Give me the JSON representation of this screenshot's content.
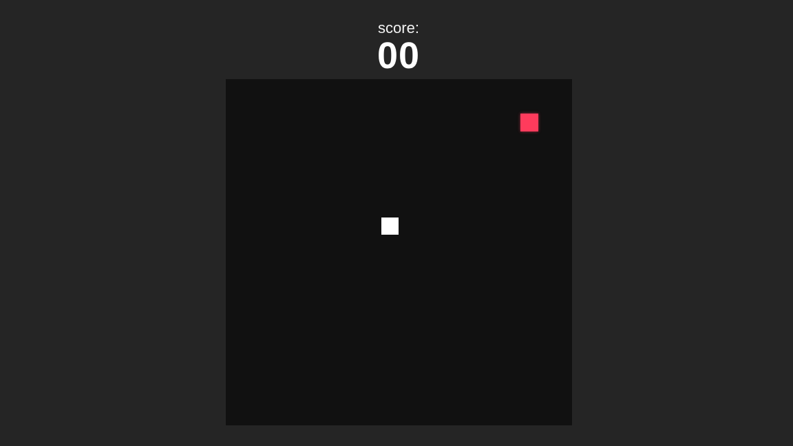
{
  "score": {
    "label": "score:",
    "value": "00"
  },
  "board": {
    "grid_columns": 20,
    "grid_rows": 20,
    "background_color": "#111111"
  },
  "snake": {
    "color": "#ffffff",
    "segments": [
      {
        "col": 9,
        "row": 8
      }
    ]
  },
  "food": {
    "color": "#ff3b5c",
    "col": 17,
    "row": 2
  }
}
